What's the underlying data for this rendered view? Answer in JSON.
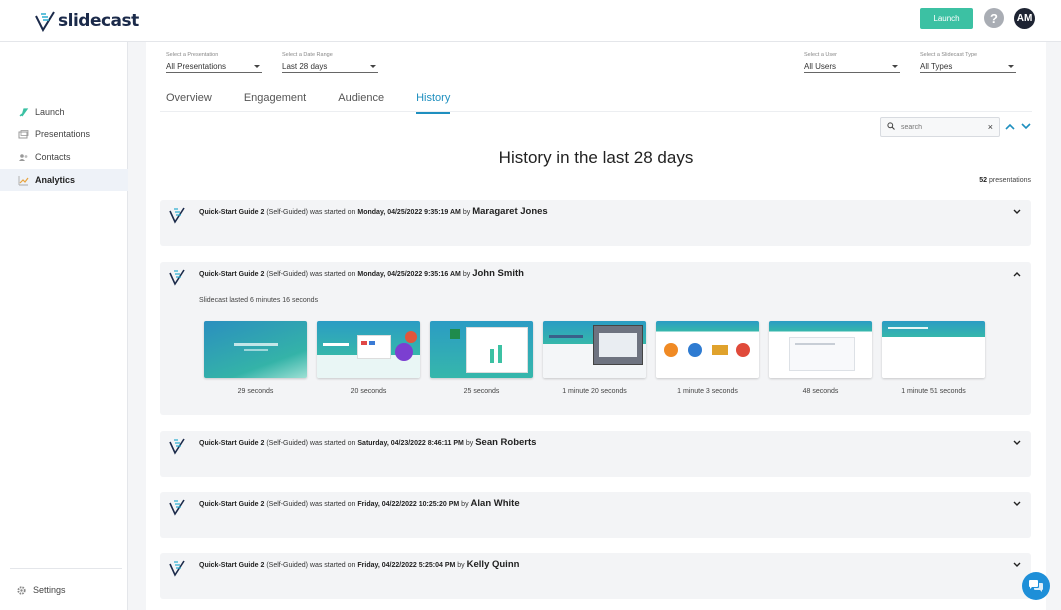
{
  "app": {
    "logo_text": "slidecast",
    "launch_label": "Launch",
    "help_label": "?",
    "avatar_initials": "AM",
    "accent": "#3cc1a3",
    "link": "#1e8fbf"
  },
  "sidebar": {
    "items": [
      {
        "label": "Launch",
        "icon": "rocket-icon"
      },
      {
        "label": "Presentations",
        "icon": "slides-icon"
      },
      {
        "label": "Contacts",
        "icon": "users-icon"
      },
      {
        "label": "Analytics",
        "icon": "chart-icon",
        "active": true
      }
    ],
    "settings_label": "Settings"
  },
  "filters": {
    "presentation": {
      "label": "Select a Presentation",
      "value": "All Presentations"
    },
    "date_range": {
      "label": "Select a Date Range",
      "value": "Last 28 days"
    },
    "user": {
      "label": "Select a User",
      "value": "All Users"
    },
    "type": {
      "label": "Select a Slidecast Type",
      "value": "All Types"
    }
  },
  "tabs": [
    {
      "label": "Overview"
    },
    {
      "label": "Engagement"
    },
    {
      "label": "Audience"
    },
    {
      "label": "History",
      "active": true
    }
  ],
  "search": {
    "placeholder": "search",
    "clear": "×"
  },
  "page": {
    "title": "History in the last 28 days",
    "count_number": "52",
    "count_label": "presentations"
  },
  "history": [
    {
      "name": "Quick-Start Guide 2",
      "kind": "(Self-Guided)",
      "verb": "was started on",
      "date": "Monday, 04/25/2022 9:35:19 AM",
      "by": "by",
      "who": "Maragaret Jones",
      "expanded": false
    },
    {
      "name": "Quick-Start Guide 2",
      "kind": "(Self-Guided)",
      "verb": "was started on",
      "date": "Monday, 04/25/2022 9:35:16 AM",
      "by": "by",
      "who": "John Smith",
      "expanded": true,
      "lasted": "Slidecast lasted 6 minutes 16 seconds",
      "slides": [
        {
          "caption": "29 seconds"
        },
        {
          "caption": "20 seconds"
        },
        {
          "caption": "25 seconds"
        },
        {
          "caption": "1 minute 20 seconds"
        },
        {
          "caption": "1 minute 3 seconds"
        },
        {
          "caption": "48 seconds"
        },
        {
          "caption": "1 minute 51 seconds"
        }
      ]
    },
    {
      "name": "Quick-Start Guide 2",
      "kind": "(Self-Guided)",
      "verb": "was started on",
      "date": "Saturday, 04/23/2022 8:46:11 PM",
      "by": "by",
      "who": "Sean Roberts",
      "expanded": false
    },
    {
      "name": "Quick-Start Guide 2",
      "kind": "(Self-Guided)",
      "verb": "was started on",
      "date": "Friday, 04/22/2022 10:25:20 PM",
      "by": "by",
      "who": "Alan White",
      "expanded": false
    },
    {
      "name": "Quick-Start Guide 2",
      "kind": "(Self-Guided)",
      "verb": "was started on",
      "date": "Friday, 04/22/2022 5:25:04 PM",
      "by": "by",
      "who": "Kelly Quinn",
      "expanded": false
    }
  ]
}
